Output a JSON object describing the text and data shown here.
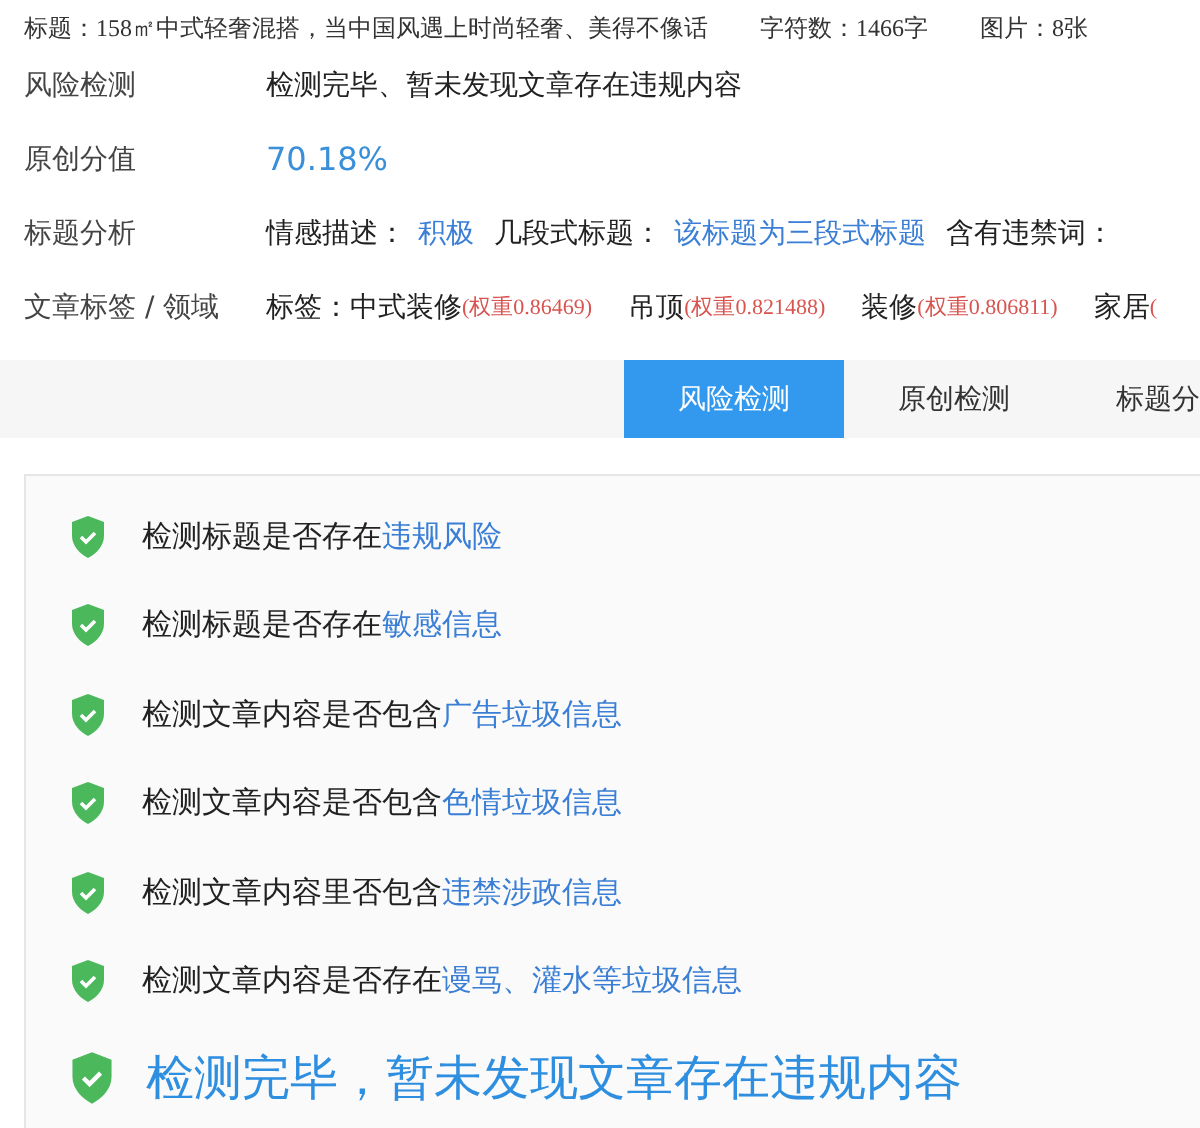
{
  "header": [
    {
      "label": "标题：",
      "value": "158㎡中式轻奢混搭，当中国风遇上时尚轻奢、美得不像话"
    },
    {
      "label": "字符数：",
      "value": "1466字"
    },
    {
      "label": "图片：",
      "value": "8张"
    }
  ],
  "risk": {
    "label": "风险检测",
    "value": "检测完毕、暂未发现文章存在违规内容"
  },
  "originality": {
    "label": "原创分值",
    "value": "70.18%"
  },
  "title_analysis": {
    "label": "标题分析",
    "fields": [
      {
        "label": "情感描述：",
        "value": "积极"
      },
      {
        "label": "几段式标题：",
        "value": "该标题为三段式标题"
      },
      {
        "label": "含有违禁词："
      }
    ]
  },
  "tags": {
    "label": "文章标签 / 领域",
    "prefix": "标签：",
    "items": [
      {
        "name": "中式装修",
        "weight": "(权重0.86469)"
      },
      {
        "name": "吊顶",
        "weight": "(权重0.821488)"
      },
      {
        "name": "装修",
        "weight": "(权重0.806811)"
      },
      {
        "name": "家居",
        "weight": "("
      }
    ]
  },
  "tabs": [
    {
      "label": "风险检测",
      "selected": true
    },
    {
      "label": "原创检测",
      "selected": false
    },
    {
      "label": "标题分",
      "selected": false
    }
  ],
  "checks": [
    {
      "text": "检测标题是否存在",
      "highlight": "违规风险",
      "passed": true
    },
    {
      "text": "检测标题是否存在",
      "highlight": "敏感信息",
      "passed": true
    },
    {
      "text": "检测文章内容是否包含",
      "highlight": "广告垃圾信息",
      "passed": true
    },
    {
      "text": "检测文章内容是否包含",
      "highlight": "色情垃圾信息",
      "passed": true
    },
    {
      "text": "检测文章内容里否包含",
      "highlight": "违禁涉政信息",
      "passed": true
    },
    {
      "text": "检测文章内容是否存在",
      "highlight": "谩骂、灌水等垃圾信息",
      "passed": true
    }
  ],
  "result": {
    "text": "检测完毕，暂未发现文章存在违规内容",
    "passed": true
  }
}
